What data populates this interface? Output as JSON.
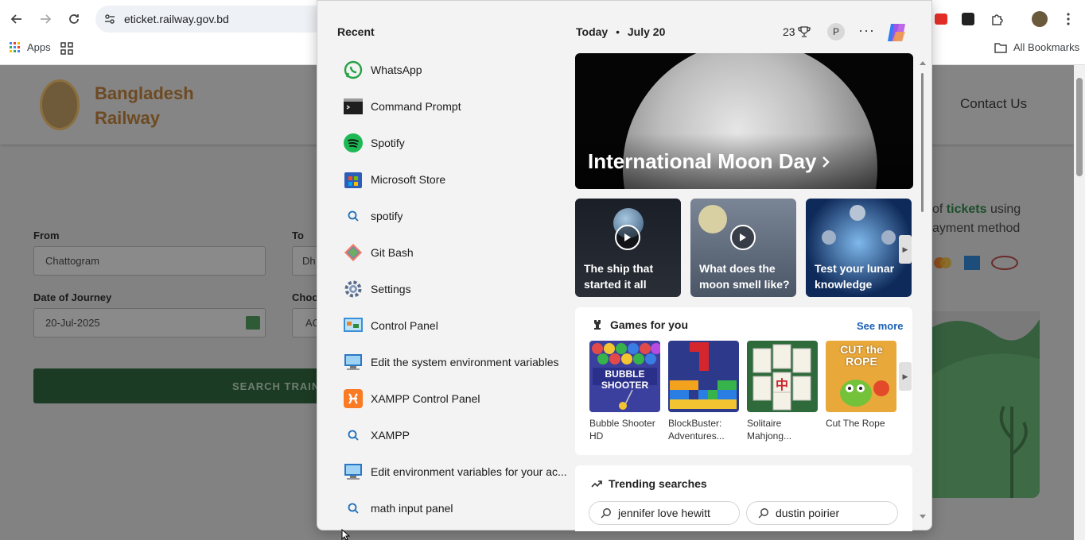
{
  "browser": {
    "url": "eticket.railway.gov.bd",
    "apps_label": "Apps",
    "all_bookmarks_label": "All Bookmarks"
  },
  "site": {
    "brand_line1": "Bangladesh",
    "brand_line2": "Railway",
    "contact_label": "Contact Us",
    "from_label": "From",
    "from_value": "Chattogram",
    "to_label": "To",
    "to_value": "Dh",
    "date_label": "Date of Journey",
    "date_value": "20-Jul-2025",
    "class_label": "Choo",
    "class_value": "AC",
    "search_button": "SEARCH TRAIN",
    "promo_line1_prefix": "of ",
    "promo_line1_bold": "tickets",
    "promo_line1_suffix": " using",
    "promo_line2": "ayment method"
  },
  "start_menu": {
    "recent_title": "Recent",
    "recent": [
      {
        "label": "WhatsApp",
        "icon": "whatsapp-icon"
      },
      {
        "label": "Command Prompt",
        "icon": "command-prompt-icon"
      },
      {
        "label": "Spotify",
        "icon": "spotify-icon"
      },
      {
        "label": "Microsoft Store",
        "icon": "microsoft-store-icon"
      },
      {
        "label": "spotify",
        "icon": "search-icon"
      },
      {
        "label": "Git Bash",
        "icon": "git-bash-icon"
      },
      {
        "label": "Settings",
        "icon": "settings-icon"
      },
      {
        "label": "Control Panel",
        "icon": "control-panel-icon"
      },
      {
        "label": "Edit the system environment variables",
        "icon": "system-properties-icon"
      },
      {
        "label": "XAMPP Control Panel",
        "icon": "xampp-icon"
      },
      {
        "label": "XAMPP",
        "icon": "search-icon"
      },
      {
        "label": "Edit environment variables for your ac...",
        "icon": "system-properties-icon"
      },
      {
        "label": "math input panel",
        "icon": "search-icon"
      }
    ],
    "today_label": "Today",
    "date": "July 20",
    "points": "23",
    "profile_initial": "P",
    "hero_title": "International Moon Day",
    "tiles": [
      {
        "caption": "The ship that started it all",
        "has_video": true
      },
      {
        "caption": "What does the moon smell like?",
        "has_video": true
      },
      {
        "caption": "Test your lunar knowledge",
        "has_video": false
      }
    ],
    "games_title": "Games for you",
    "see_more": "See more",
    "games": [
      {
        "name": "Bubble Shooter HD",
        "thumb_text": "BUBBLE SHOOTER"
      },
      {
        "name": "BlockBuster: Adventures...",
        "thumb_text": ""
      },
      {
        "name": "Solitaire Mahjong...",
        "thumb_text": "中"
      },
      {
        "name": "Cut The Rope",
        "thumb_text": "CUT the ROPE"
      }
    ],
    "trending_title": "Trending searches",
    "trending": [
      "jennifer love hewitt",
      "dustin poirier"
    ]
  },
  "colors": {
    "accent_green": "#1c3b24",
    "link_blue": "#1a5fb4",
    "brand_brown": "#6d4a22"
  }
}
